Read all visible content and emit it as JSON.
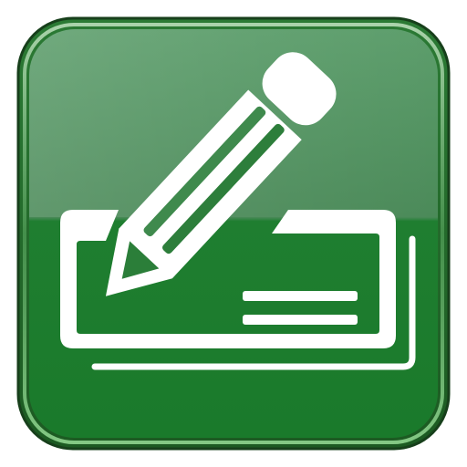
{
  "app_icon": {
    "name": "checkbook-pencil-icon",
    "depicts": [
      "checkbook-icon",
      "pencil-icon"
    ],
    "colors": {
      "frame_outer": "#1f5a25",
      "frame_inner": "#2f8a3a",
      "tile_top": "#5a9c6a",
      "tile_mid": "#4a8a58",
      "tile_bottom": "#1e7a2e",
      "tile_bottom_dark": "#166a24",
      "glyph": "#ffffff",
      "glyph_stroke": "#ffffff",
      "check_fill": "#1b6e2a"
    }
  }
}
